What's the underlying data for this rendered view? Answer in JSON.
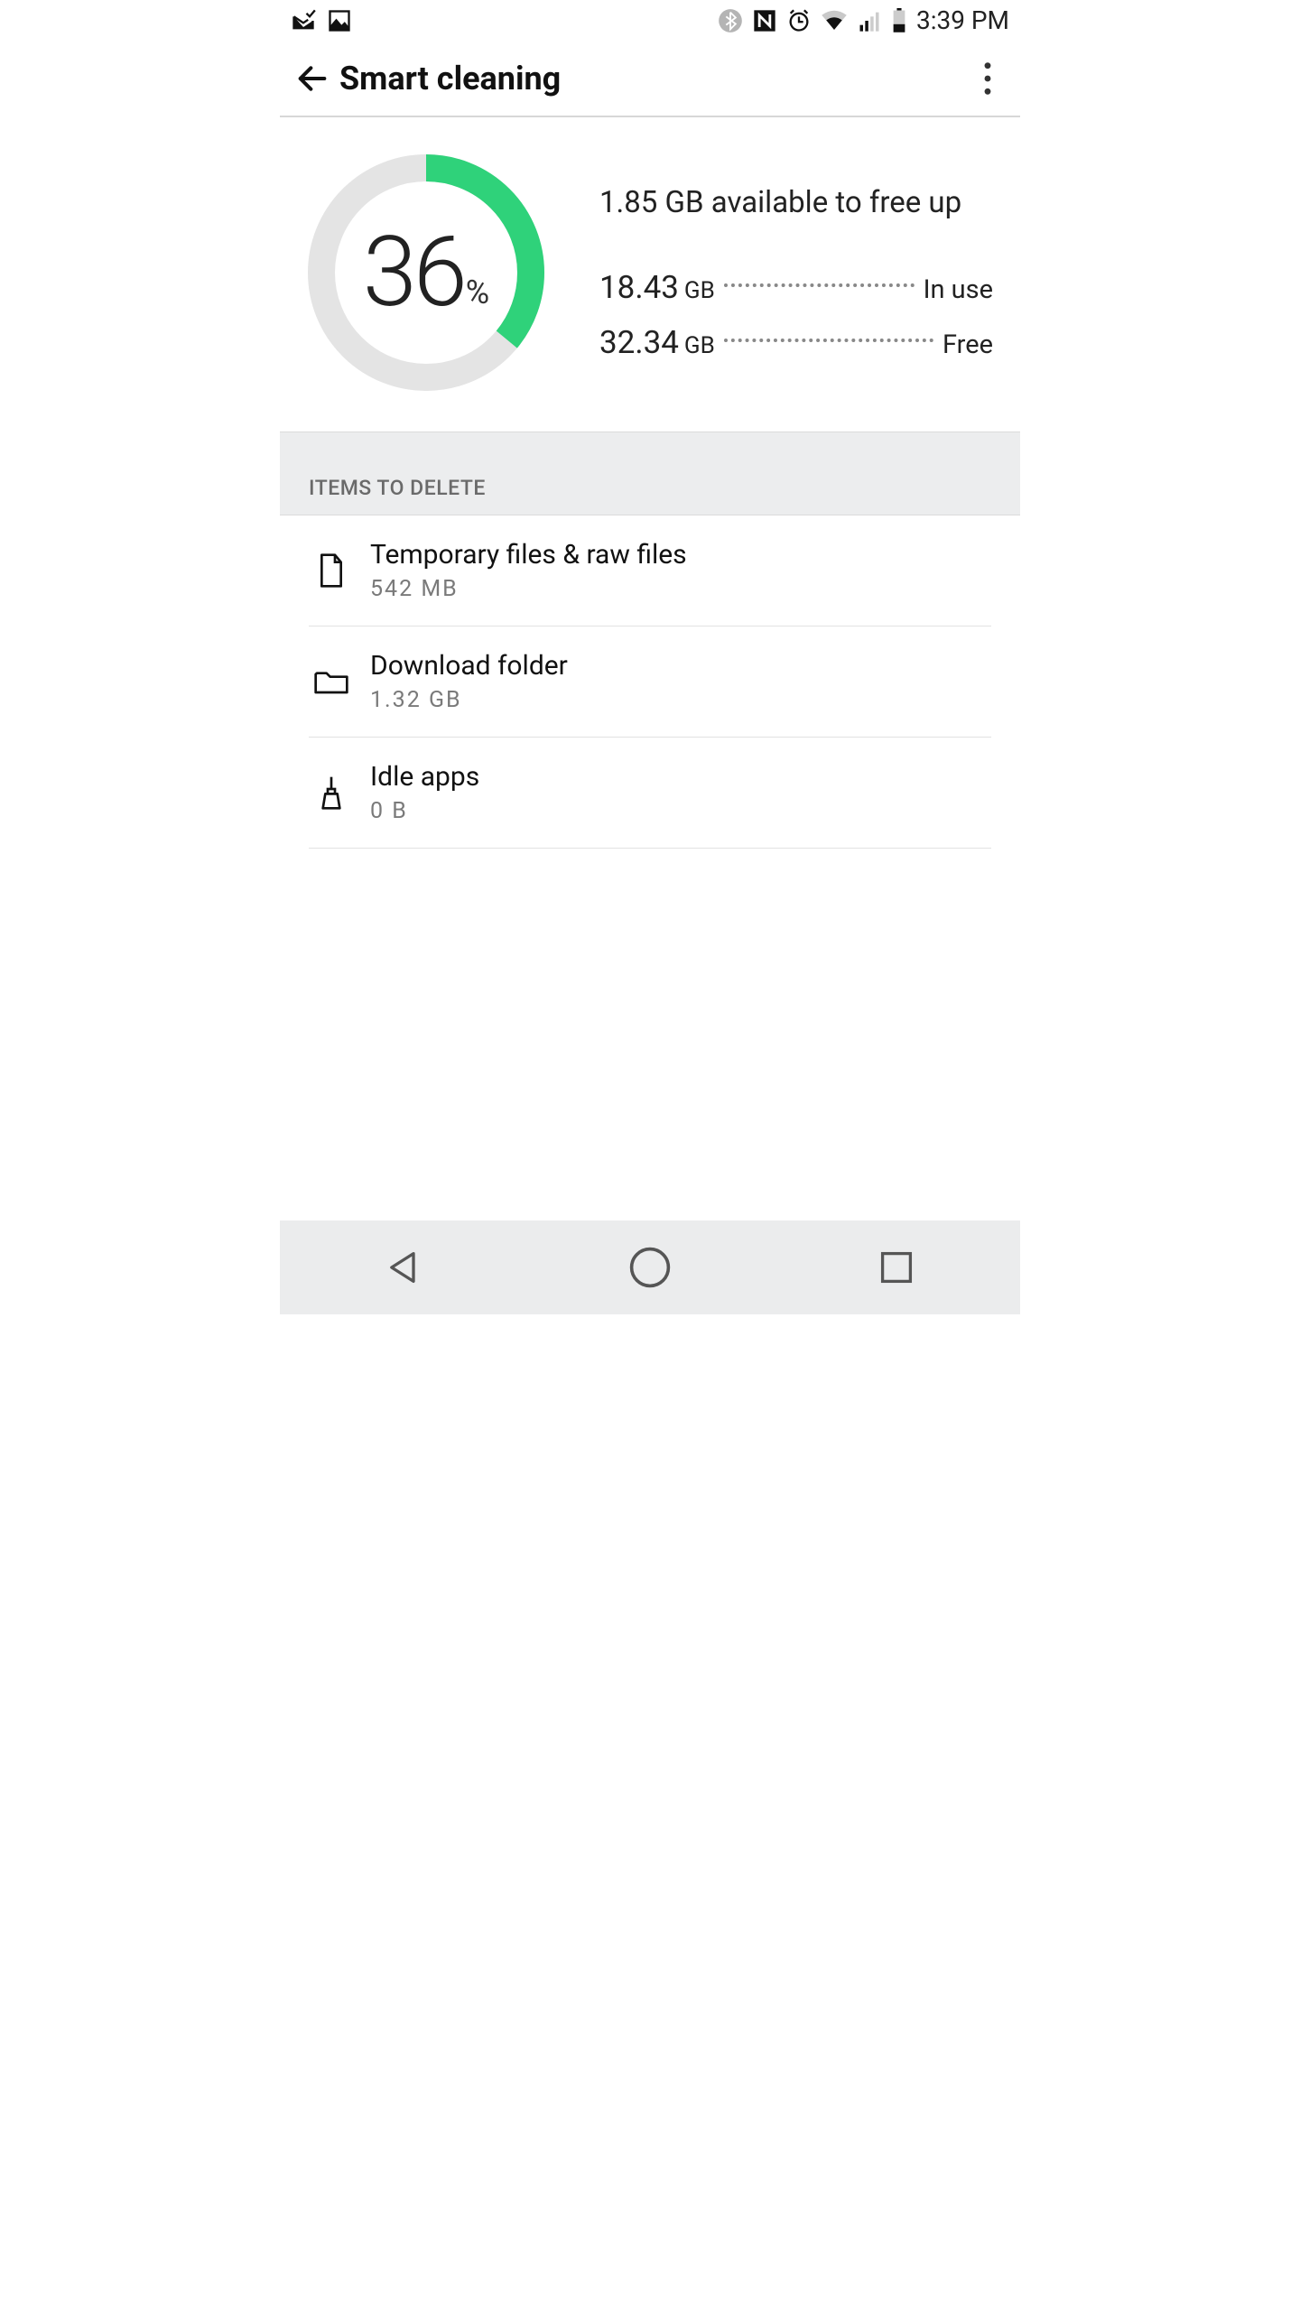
{
  "status": {
    "time": "3:39 PM"
  },
  "appbar": {
    "title": "Smart cleaning"
  },
  "chart_data": {
    "type": "pie",
    "title": "Storage usage percent",
    "series": [
      {
        "name": "In use",
        "value": 36
      },
      {
        "name": "Free",
        "value": 64
      }
    ],
    "percent_display": "36",
    "percent_sign": "%"
  },
  "summary": {
    "available_line": "1.85 GB available to free up",
    "rows": [
      {
        "value": "18.43",
        "unit": "GB",
        "label": "In use"
      },
      {
        "value": "32.34",
        "unit": "GB",
        "label": "Free"
      }
    ]
  },
  "section_header": "ITEMS TO DELETE",
  "items": [
    {
      "title": "Temporary files & raw files",
      "size": "542  MB"
    },
    {
      "title": "Download folder",
      "size": "1.32  GB"
    },
    {
      "title": "Idle apps",
      "size": "0  B"
    }
  ]
}
